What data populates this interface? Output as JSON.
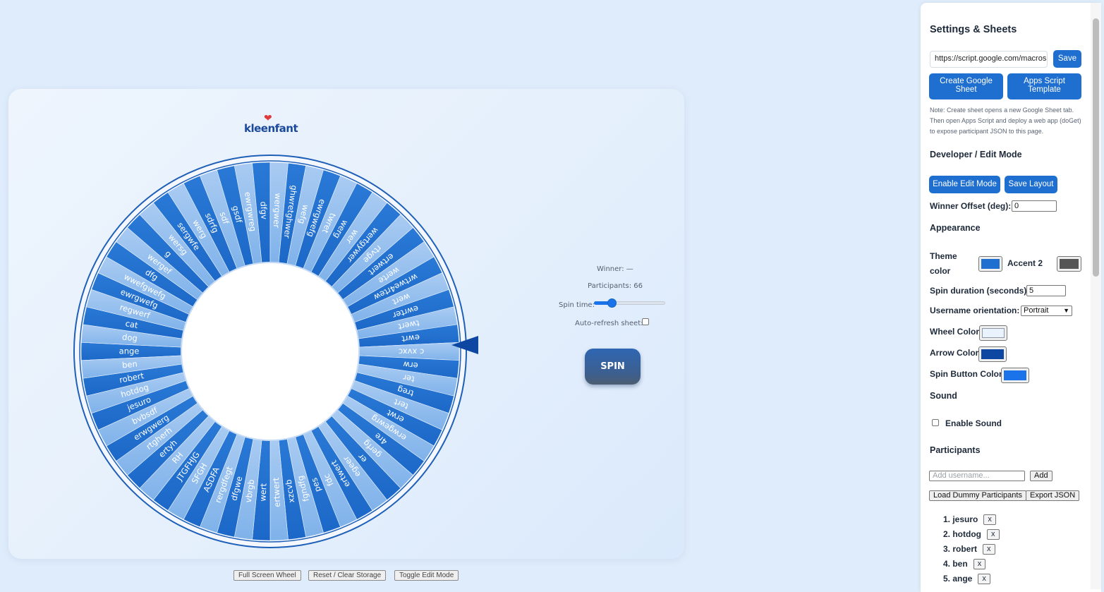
{
  "colors": {
    "theme": "#1e6fd0",
    "accent2": "#555555",
    "wheel_color": "#eaf2fd",
    "arrow_color": "#0d47a1",
    "spin_button_color": "#1a73e8",
    "segment_dark": "#2a79d6",
    "segment_light": "#a9cbf2"
  },
  "logo": {
    "text": "kleenfant",
    "heart_icon": "heart-icon"
  },
  "wheel": {
    "participants": [
      "ange",
      "dog",
      "cat",
      "regwerf",
      "ewrgwefg",
      "wwefgwefg",
      "dfg",
      "wergef",
      "g",
      "wersg",
      "sergwfe",
      "werg",
      "sdrfg",
      "sdf",
      "gsdf",
      "ewrgwreg",
      "dfgv",
      "wergwer",
      "ghwretghwer",
      "wefg",
      "ewrgwefg",
      "twret",
      "werg",
      "wer",
      "wertgywer",
      "rtvge",
      "ertwert",
      "werte",
      "wrtwe4rtew",
      "wert",
      "ewrter",
      "twert",
      "ewrt",
      "c xvxc",
      "erw",
      "ter",
      "treg",
      "tert",
      "erwt",
      "erwgewrg",
      "4re",
      "gerfg",
      "er",
      "egeer",
      "ertwert",
      "fdc",
      "pes",
      "fgndfg",
      "xzcvb",
      "ertwert",
      "wert",
      "vbrgb",
      "dfgwe",
      "rergdfegt",
      "ASDFA",
      "SFGH",
      "JTGFHJG",
      "RH",
      "ertyh",
      "rtgherh",
      "erwgwerg",
      "bvbsdf",
      "jesuro",
      "hotdog",
      "robert",
      "ben"
    ]
  },
  "panel": {
    "winner": "Winner: —",
    "participants_count": "Participants: 66",
    "spin_time_label": "Spin time:",
    "spin_time_value": 0.22,
    "auto_refresh_label": "Auto-refresh sheet:",
    "spin_label": "SPIN"
  },
  "bottom_buttons": {
    "full_screen": "Full Screen Wheel",
    "reset": "Reset / Clear Storage",
    "toggle_edit": "Toggle Edit Mode"
  },
  "sidebar": {
    "title": "Settings & Sheets",
    "url_value": "https://script.google.com/macros",
    "save_label": "Save",
    "create_sheet_label": "Create Google Sheet",
    "apps_script_label": "Apps Script Template",
    "note": "Note: Create sheet opens a new Google Sheet tab. Then open Apps Script and deploy a web app (doGet) to expose participant JSON to this page.",
    "dev_heading": "Developer / Edit Mode",
    "enable_edit_label": "Enable Edit Mode",
    "save_layout_label": "Save Layout",
    "winner_offset_label": "Winner Offset (deg):",
    "winner_offset_value": "0",
    "appearance_heading": "Appearance",
    "theme_color_label": "Theme color",
    "accent2_label": "Accent 2",
    "spin_duration_label": "Spin duration (seconds):",
    "spin_duration_value": "5",
    "orientation_label": "Username orientation:",
    "orientation_value": "Portrait",
    "wheel_color_label": "Wheel Color",
    "arrow_color_label": "Arrow Color",
    "spin_button_color_label": "Spin Button Color",
    "sound_heading": "Sound",
    "enable_sound_label": "Enable Sound",
    "participants_heading": "Participants",
    "add_placeholder": "Add username...",
    "add_label": "Add",
    "load_dummy_label": "Load Dummy Participants",
    "export_label": "Export JSON",
    "remove_label": "x",
    "list": [
      "1. jesuro",
      "2. hotdog",
      "3. robert",
      "4. ben",
      "5. ange"
    ]
  }
}
